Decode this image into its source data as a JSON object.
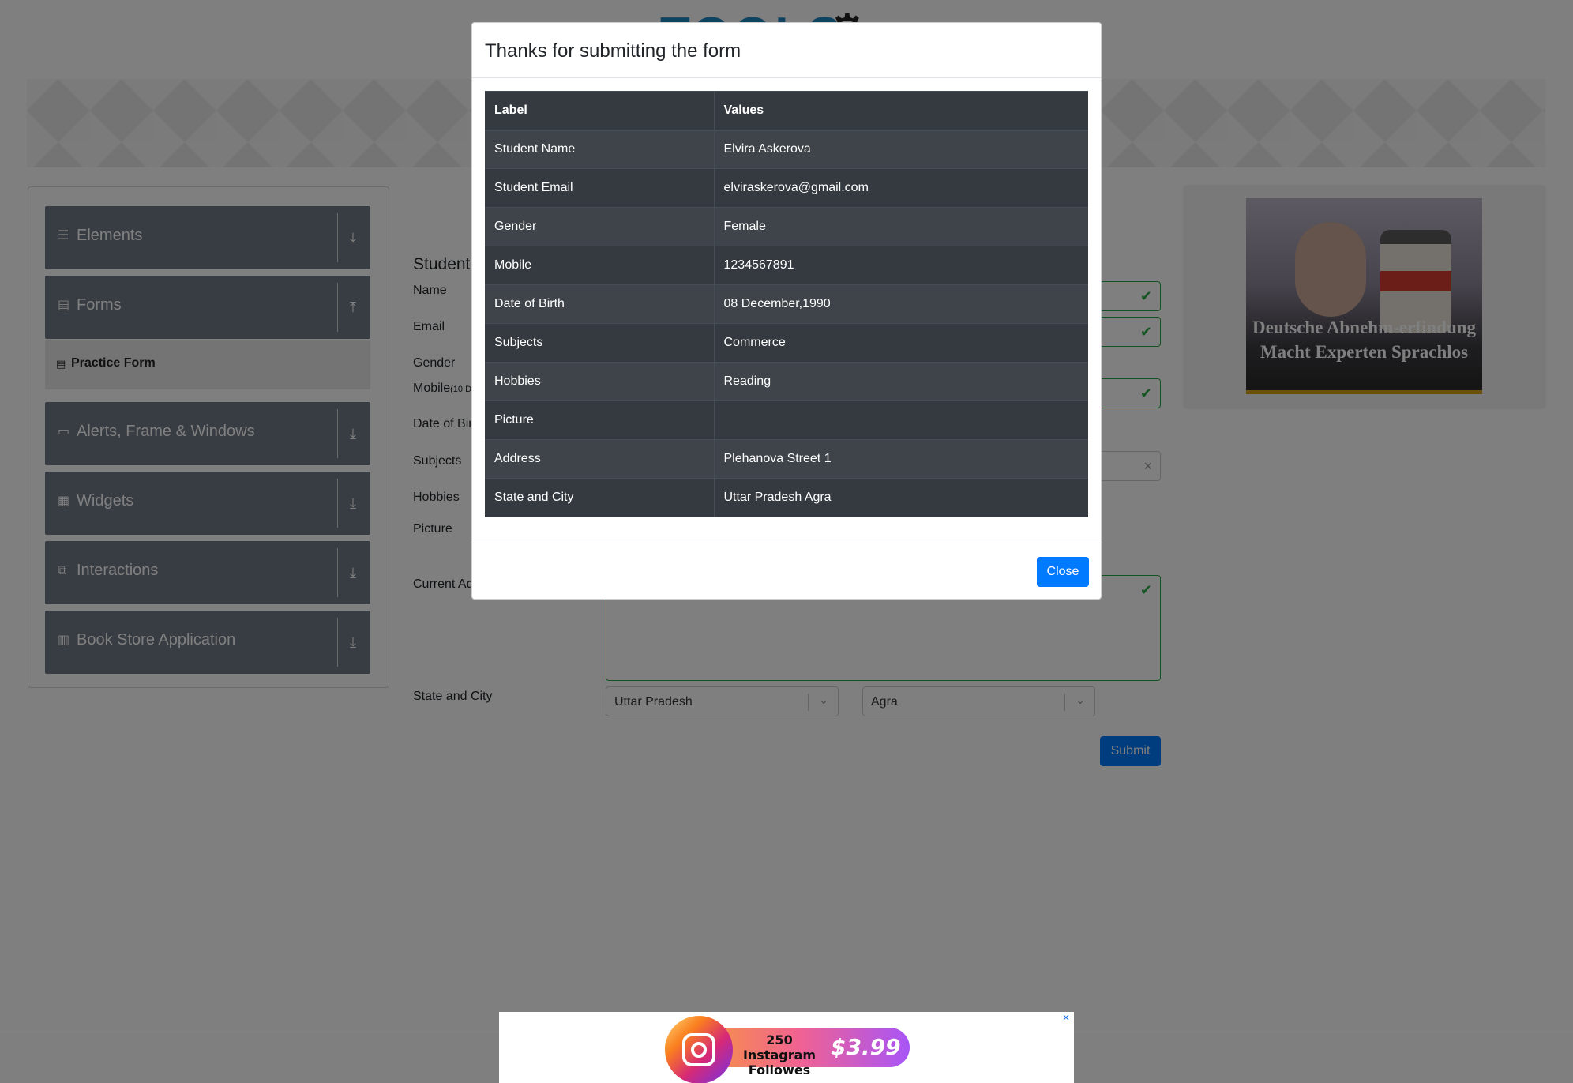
{
  "sidebar": {
    "groups": [
      {
        "label": "Elements",
        "icon": "list-icon"
      },
      {
        "label": "Forms",
        "icon": "document-icon"
      },
      {
        "label": "Alerts, Frame & Windows",
        "icon": "window-icon"
      },
      {
        "label": "Widgets",
        "icon": "widgets-icon"
      },
      {
        "label": "Interactions",
        "icon": "interactions-icon"
      },
      {
        "label": "Book Store Application",
        "icon": "books-icon"
      }
    ],
    "active_item": "Practice Form"
  },
  "form": {
    "title": "Student",
    "labels": {
      "name": "Name",
      "email": "Email",
      "gender": "Gender",
      "mobile": "Mobile",
      "mobile_hint": "(10 D",
      "dob": "Date of Bir",
      "subjects": "Subjects",
      "hobbies": "Hobbies",
      "picture": "Picture",
      "address": "Current Ad",
      "state_city": "State and City"
    },
    "state_value": "Uttar Pradesh",
    "city_value": "Agra",
    "submit_label": "Submit"
  },
  "right_ad": {
    "caption": "Deutsche Abnehm-erfindung Macht Experten Sprachlos"
  },
  "modal": {
    "title": "Thanks for submitting the form",
    "columns": [
      "Label",
      "Values"
    ],
    "rows": [
      {
        "label": "Student Name",
        "value": "Elvira Askerova"
      },
      {
        "label": "Student Email",
        "value": "elviraskerova@gmail.com"
      },
      {
        "label": "Gender",
        "value": "Female"
      },
      {
        "label": "Mobile",
        "value": "1234567891"
      },
      {
        "label": "Date of Birth",
        "value": "08 December,1990"
      },
      {
        "label": "Subjects",
        "value": "Commerce"
      },
      {
        "label": "Hobbies",
        "value": "Reading"
      },
      {
        "label": "Picture",
        "value": ""
      },
      {
        "label": "Address",
        "value": "Plehanova Street 1"
      },
      {
        "label": "State and City",
        "value": "Uttar Pradesh Agra"
      }
    ],
    "close_label": "Close"
  },
  "bottom_ad": {
    "text": "250 Instagram Followes",
    "price": "$3.99",
    "close_glyph": "×"
  },
  "colors": {
    "primary": "#007bff",
    "sidebar_group": "#717b87",
    "table_dark": "#343a40",
    "valid": "#28a745"
  }
}
